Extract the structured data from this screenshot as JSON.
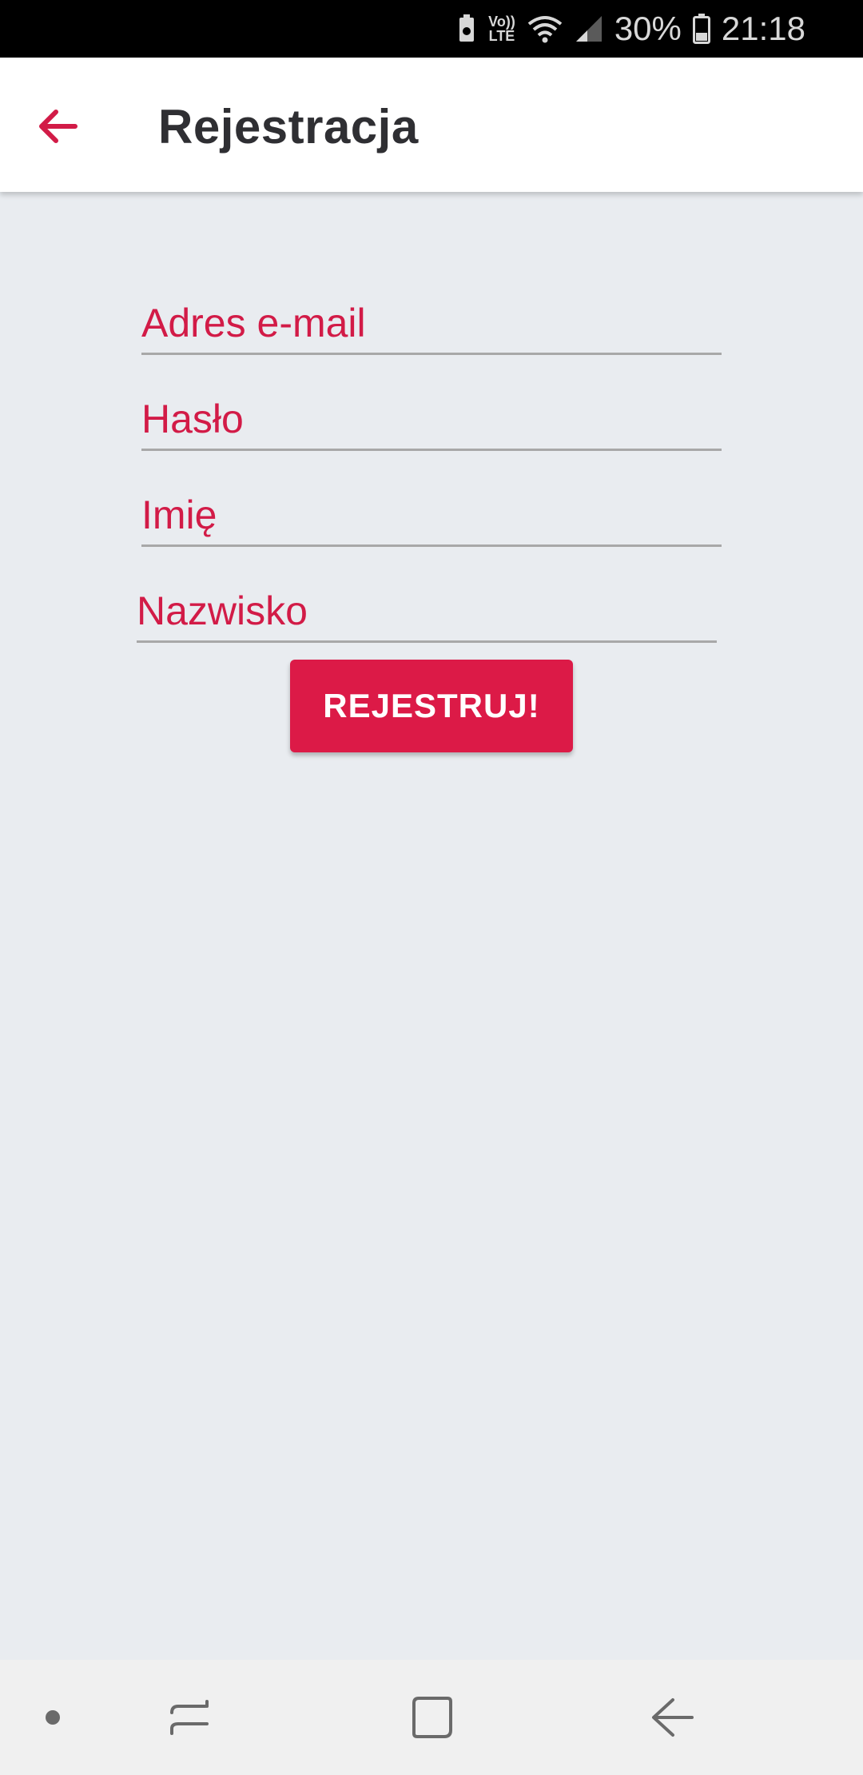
{
  "status_bar": {
    "battery_percent": "30%",
    "time": "21:18",
    "volte_top": "Vo))",
    "volte_bottom": "LTE",
    "icons": [
      "battery-saver-icon",
      "volte-icon",
      "wifi-icon",
      "signal-icon",
      "battery-icon"
    ]
  },
  "app_bar": {
    "title": "Rejestracja",
    "back_icon": "arrow-back-icon"
  },
  "form": {
    "email": {
      "value": "",
      "placeholder": "Adres e-mail"
    },
    "password": {
      "value": "",
      "placeholder": "Hasło"
    },
    "first_name": {
      "value": "",
      "placeholder": "Imię"
    },
    "last_name": {
      "value": "",
      "placeholder": "Nazwisko"
    },
    "submit_label": "REJESTRUJ!"
  },
  "nav_bar": {
    "icons": [
      "dot-icon",
      "recents-icon",
      "home-icon",
      "back-icon"
    ]
  },
  "colors": {
    "accent": "#dc1a47",
    "hint_text": "#d21b47",
    "background": "#e9ecf0",
    "title_text": "#2f2f33"
  }
}
